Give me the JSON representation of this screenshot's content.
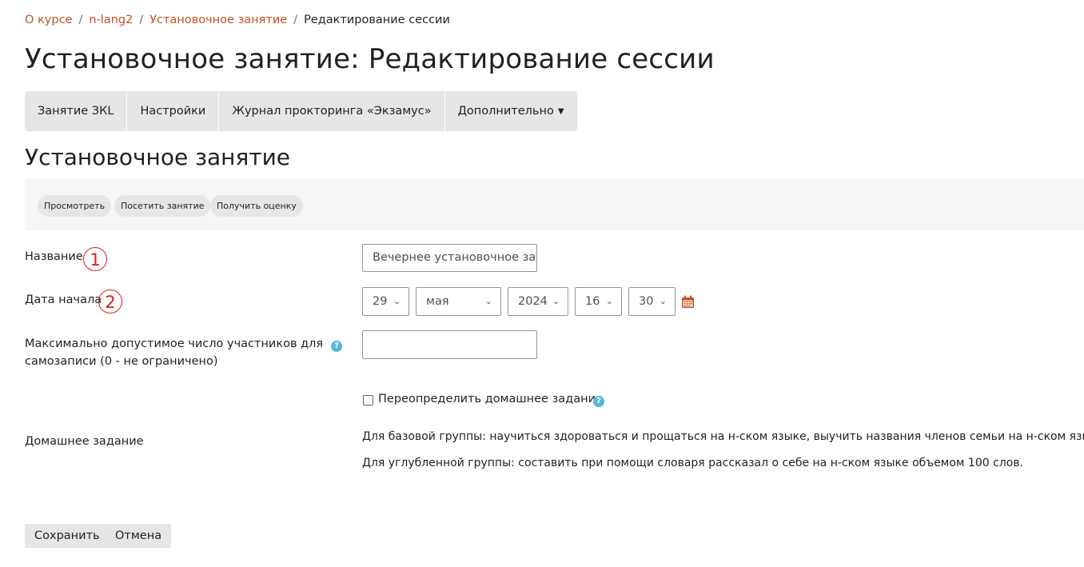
{
  "breadcrumb": {
    "items": [
      "О курсе",
      "n-lang2",
      "Установочное занятие"
    ],
    "current": "Редактирование сессии"
  },
  "page_title": "Установочное занятие: Редактирование сессии",
  "tabs": [
    {
      "label": "Занятие ЗКL"
    },
    {
      "label": "Настройки"
    },
    {
      "label": "Журнал прокторинга «Экзамус»"
    },
    {
      "label": "Дополнительно"
    }
  ],
  "section_title": "Установочное занятие",
  "actions": [
    "Просмотреть",
    "Посетить занятие",
    "Получить оценку"
  ],
  "form": {
    "name_label": "Название",
    "name_value": "Вечернее установочное занятие",
    "start_label": "Дата начала",
    "start": {
      "day": "29",
      "month": "мая",
      "year": "2024",
      "hour": "16",
      "minute": "30"
    },
    "max_label_line1": "Максимально допустимое число участников для",
    "max_label_line2": "самозаписи (0 - не ограничено)",
    "max_value": "",
    "override_label": "Переопределить домашнее задание",
    "override_checked": false,
    "homework_label": "Домашнее задание",
    "homework_line1": "Для базовой группы: научиться здороваться и прощаться на н-ском языке, выучить названия членов семьи на н-ском языке.",
    "homework_line2": "Для углубленной группы: составить при помощи словаря рассказал о себе на н-ском языке объемом 100 слов."
  },
  "annotations": [
    "1",
    "2"
  ],
  "buttons": {
    "save": "Сохранить",
    "cancel": "Отмена"
  },
  "icons": {
    "tab_more": "chevron-down-icon",
    "date": "calendar-icon",
    "help": "question-circle-icon"
  },
  "colors": {
    "link": "#c4511d",
    "marker": "#d81d1d",
    "help": "#55b7d8",
    "calendar": "#c4511d"
  }
}
